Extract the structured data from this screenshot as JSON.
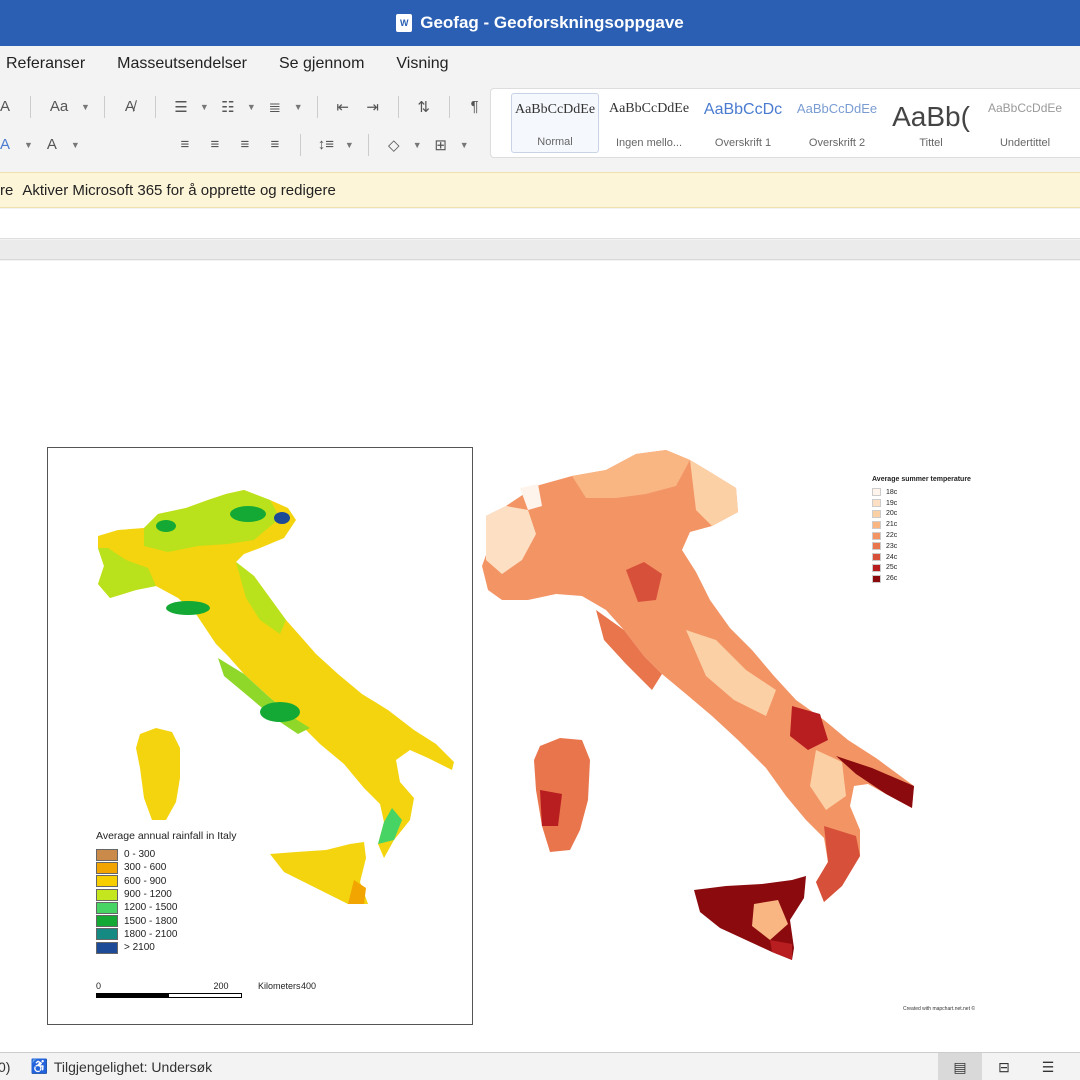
{
  "window": {
    "title": "Geofag - Geoforskningsoppgave",
    "app_icon": "word-icon"
  },
  "menu": [
    "Referanser",
    "Masseutsendelser",
    "Se gjennom",
    "Visning"
  ],
  "ribbon": {
    "styles": [
      {
        "preview": "AaBbCcDdEe",
        "name": "Normal"
      },
      {
        "preview": "AaBbCcDdEe",
        "name": "Ingen mello..."
      },
      {
        "preview": "AaBbCcDc",
        "name": "Overskrift 1"
      },
      {
        "preview": "AaBbCcDdEe",
        "name": "Overskrift 2"
      },
      {
        "preview": "AaBb(",
        "name": "Tittel"
      },
      {
        "preview": "AaBbCcDdEe",
        "name": "Undertittel"
      }
    ],
    "font_case_label": "Aa",
    "font_color_label": "A"
  },
  "notice": {
    "prefix": "re",
    "text": "Aktiver Microsoft 365 for å opprette og redigere"
  },
  "map_rainfall": {
    "legend_title": "Average annual rainfall in Italy",
    "legend": [
      {
        "label": "0 - 300",
        "color": "#c98a4a"
      },
      {
        "label": "300 - 600",
        "color": "#f2a400"
      },
      {
        "label": "600 - 900",
        "color": "#f7cf00"
      },
      {
        "label": "900 - 1200",
        "color": "#c4e61e"
      },
      {
        "label": "1200 - 1500",
        "color": "#47d464"
      },
      {
        "label": "1500 - 1800",
        "color": "#13a934"
      },
      {
        "label": "1800 - 2100",
        "color": "#148a82"
      },
      {
        "label": "> 2100",
        "color": "#1d4a96"
      }
    ],
    "scale": {
      "ticks": [
        "0",
        "200",
        "400"
      ],
      "unit": "Kilometers"
    }
  },
  "map_temperature": {
    "legend_title": "Average summer temperature",
    "legend": [
      {
        "label": "18c",
        "color": "#fff4ec"
      },
      {
        "label": "19c",
        "color": "#fde0c4"
      },
      {
        "label": "20c",
        "color": "#fcd0a5"
      },
      {
        "label": "21c",
        "color": "#f9b582"
      },
      {
        "label": "22c",
        "color": "#f39465"
      },
      {
        "label": "23c",
        "color": "#e8754c"
      },
      {
        "label": "24c",
        "color": "#d7513a"
      },
      {
        "label": "25c",
        "color": "#b81d20"
      },
      {
        "label": "26c",
        "color": "#8b0a0e"
      }
    ],
    "credit": "Created with mapchart.net.net ©"
  },
  "status": {
    "left_fragment": "0)",
    "accessibility": "Tilgjengelighet: Undersøk"
  }
}
